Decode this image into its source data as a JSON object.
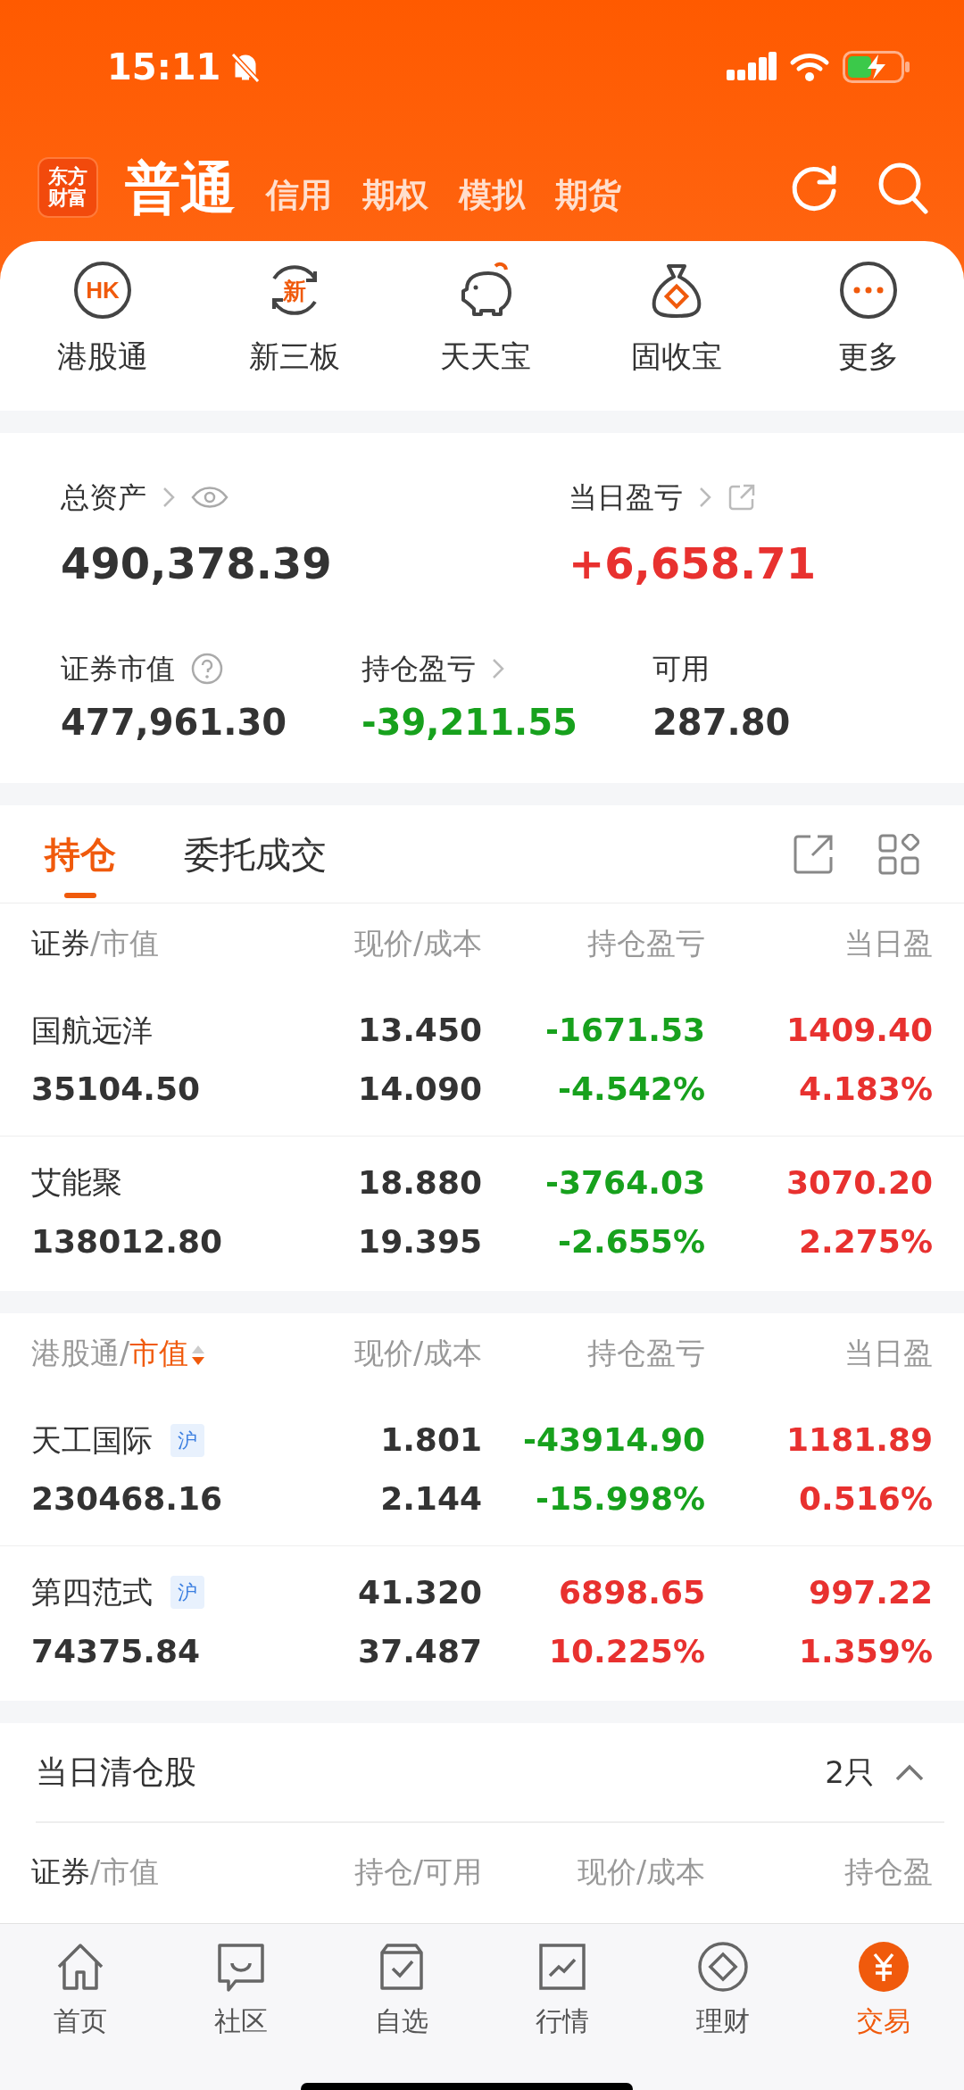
{
  "status_bar": {
    "time": "15:11"
  },
  "header": {
    "logo_lines": [
      "东方",
      "财富"
    ],
    "account_tabs": [
      {
        "label": "普通",
        "selected": true
      },
      {
        "label": "信用",
        "selected": false
      },
      {
        "label": "期权",
        "selected": false
      },
      {
        "label": "模拟",
        "selected": false
      },
      {
        "label": "期货",
        "selected": false
      }
    ]
  },
  "shortcuts": [
    {
      "kind": "hk",
      "icon_text": "HK",
      "label": "港股通"
    },
    {
      "kind": "new",
      "icon_text": "新",
      "label": "新三板"
    },
    {
      "kind": "piggy",
      "label": "天天宝"
    },
    {
      "kind": "bag",
      "label": "固收宝"
    },
    {
      "kind": "more",
      "label": "更多"
    }
  ],
  "assets": {
    "total": {
      "label": "总资产",
      "value": "490,378.39"
    },
    "daily": {
      "label": "当日盈亏",
      "value": "+6,658.71",
      "gain": true
    },
    "stats": [
      {
        "label": "证券市值",
        "kind": "help",
        "value": "477,961.30"
      },
      {
        "label": "持仓盈亏",
        "kind": "link",
        "value": "-39,211.55",
        "gain": false
      },
      {
        "label": "可用",
        "kind": "plain",
        "value": "287.80"
      }
    ]
  },
  "holding_tabs": [
    {
      "label": "持仓",
      "selected": true
    },
    {
      "label": "委托成交",
      "selected": false
    }
  ],
  "sections": [
    {
      "columns": [
        {
          "parts": [
            {
              "text": "证券",
              "muted": false
            },
            {
              "text": "/市值",
              "muted": true
            }
          ],
          "sorted": false
        },
        {
          "parts": [
            {
              "text": "现价/成本",
              "muted": true
            }
          ]
        },
        {
          "parts": [
            {
              "text": "持仓盈亏",
              "muted": true
            }
          ]
        },
        {
          "parts": [
            {
              "text": "当日盈",
              "muted": true
            }
          ]
        }
      ],
      "rows": [
        {
          "name": "国航远洋",
          "market_value": "35104.50",
          "price": "13.450",
          "cost": "14.090",
          "pl": "-1671.53",
          "pl_pct": "-4.542%",
          "pl_gain": false,
          "day_pl": "1409.40",
          "day_pct": "4.183%",
          "day_gain": true
        },
        {
          "name": "艾能聚",
          "market_value": "138012.80",
          "price": "18.880",
          "cost": "19.395",
          "pl": "-3764.03",
          "pl_pct": "-2.655%",
          "pl_gain": false,
          "day_pl": "3070.20",
          "day_pct": "2.275%",
          "day_gain": true
        }
      ]
    },
    {
      "columns": [
        {
          "parts": [
            {
              "text": "港股通/",
              "muted": true
            },
            {
              "text": "市值",
              "highlighted": true
            }
          ],
          "sorted": true
        },
        {
          "parts": [
            {
              "text": "现价/成本",
              "muted": true
            }
          ]
        },
        {
          "parts": [
            {
              "text": "持仓盈亏",
              "muted": true
            }
          ]
        },
        {
          "parts": [
            {
              "text": "当日盈",
              "muted": true
            }
          ]
        }
      ],
      "rows": [
        {
          "name": "天工国际",
          "tag": "沪",
          "market_value": "230468.16",
          "price": "1.801",
          "cost": "2.144",
          "pl": "-43914.90",
          "pl_pct": "-15.998%",
          "pl_gain": false,
          "day_pl": "1181.89",
          "day_pct": "0.516%",
          "day_gain": true
        },
        {
          "name": "第四范式",
          "tag": "沪",
          "market_value": "74375.84",
          "price": "41.320",
          "cost": "37.487",
          "pl": "6898.65",
          "pl_pct": "10.225%",
          "pl_gain": true,
          "day_pl": "997.22",
          "day_pct": "1.359%",
          "day_gain": true
        }
      ]
    }
  ],
  "cleared": {
    "title": "当日清仓股",
    "count": "2只",
    "expanded": true,
    "columns": [
      {
        "parts": [
          {
            "text": "证券",
            "muted": false
          },
          {
            "text": "/市值",
            "muted": true
          }
        ]
      },
      {
        "parts": [
          {
            "text": "持仓/可用",
            "muted": true
          }
        ]
      },
      {
        "parts": [
          {
            "text": "现价/成本",
            "muted": true
          }
        ]
      },
      {
        "parts": [
          {
            "text": "持仓盈",
            "muted": true
          }
        ]
      }
    ]
  },
  "bottom_nav": [
    {
      "kind": "home",
      "label": "首页",
      "selected": false
    },
    {
      "kind": "chat",
      "label": "社区",
      "selected": false
    },
    {
      "kind": "check",
      "label": "自选",
      "selected": false
    },
    {
      "kind": "chart",
      "label": "行情",
      "selected": false
    },
    {
      "kind": "diamond",
      "label": "理财",
      "selected": false
    },
    {
      "kind": "yen",
      "label": "交易",
      "selected": true
    }
  ]
}
